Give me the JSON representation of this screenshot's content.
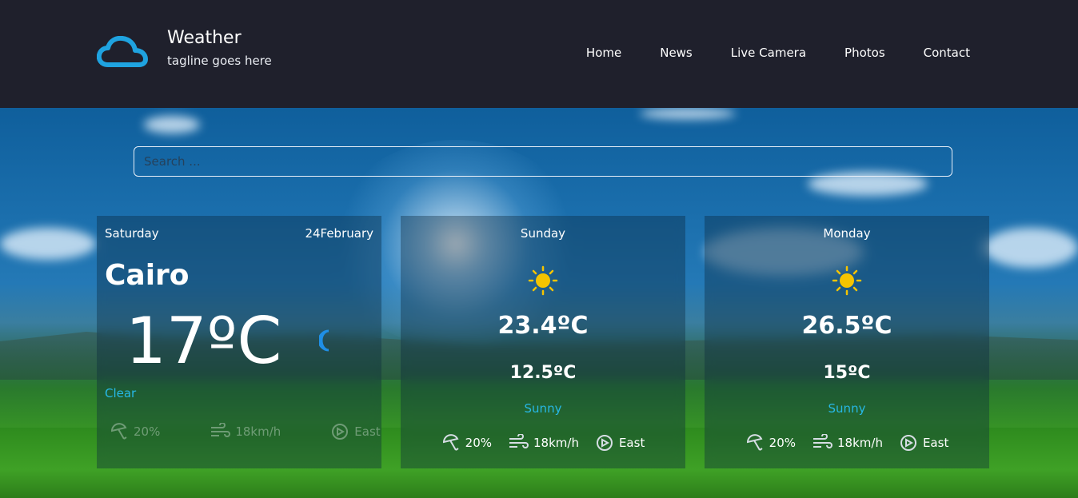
{
  "header": {
    "title": "Weather",
    "tagline": "tagline goes here",
    "nav": [
      "Home",
      "News",
      "Live Camera",
      "Photos",
      "Contact"
    ]
  },
  "search": {
    "placeholder": "Search ..."
  },
  "colors": {
    "accent": "#27b8e6",
    "header_bg": "#1f202c",
    "sun": "#f5c400"
  },
  "today": {
    "day": "Saturday",
    "date": "24February",
    "city": "Cairo",
    "temp": "17ºC",
    "condition": "Clear",
    "icon": "moon-icon",
    "rain": "20%",
    "wind": "18km/h",
    "direction": "East"
  },
  "forecast": [
    {
      "day": "Sunday",
      "icon": "sun-icon",
      "max": "23.4ºC",
      "min": "12.5ºC",
      "condition": "Sunny",
      "rain": "20%",
      "wind": "18km/h",
      "direction": "East"
    },
    {
      "day": "Monday",
      "icon": "sun-icon",
      "max": "26.5ºC",
      "min": "15ºC",
      "condition": "Sunny",
      "rain": "20%",
      "wind": "18km/h",
      "direction": "East"
    }
  ]
}
